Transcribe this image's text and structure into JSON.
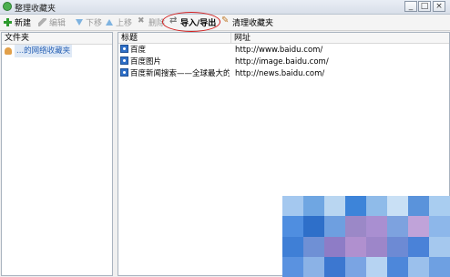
{
  "window": {
    "title": "整理收藏夹",
    "min_label": "_",
    "max_label": "□",
    "close_label": "×"
  },
  "toolbar": {
    "new": "新建",
    "edit": "编辑",
    "down": "下移",
    "up": "上移",
    "delete": "删除",
    "import_export": "导入/导出",
    "clean": "清理收藏夹"
  },
  "left": {
    "header": "文件夹",
    "tree_label": "...的网络收藏夹"
  },
  "table": {
    "col_title": "标题",
    "col_url": "网址",
    "rows": [
      {
        "title": "百度",
        "url": "http://www.baidu.com/"
      },
      {
        "title": "百度图片",
        "url": "http://image.baidu.com/"
      },
      {
        "title": "百度新闻搜索——全球最大的...",
        "url": "http://news.baidu.com/"
      }
    ]
  },
  "colors": {
    "accent_red": "#d21b1b",
    "link_blue": "#2a63b6"
  },
  "blur_colors": [
    "#a4c8ef",
    "#6fa6e2",
    "#b9d6f1",
    "#3d84d9",
    "#8fbbe9",
    "#c9e0f5",
    "#5a93db",
    "#a9cdf0",
    "#4f8ee0",
    "#2e6fc9",
    "#6e9fe0",
    "#9b88c7",
    "#a98fd1",
    "#7da2df",
    "#c0a3d9",
    "#8db7ea",
    "#3f7fd6",
    "#6f90d5",
    "#8e7cc6",
    "#b090cf",
    "#9d86c9",
    "#6d8ad4",
    "#4a82d8",
    "#a5c8ee",
    "#5a92e0",
    "#8bb2e6",
    "#3c77d0",
    "#7aa4e3",
    "#b6d3f2",
    "#4d87da",
    "#9bc0ec",
    "#6ea0e2"
  ]
}
